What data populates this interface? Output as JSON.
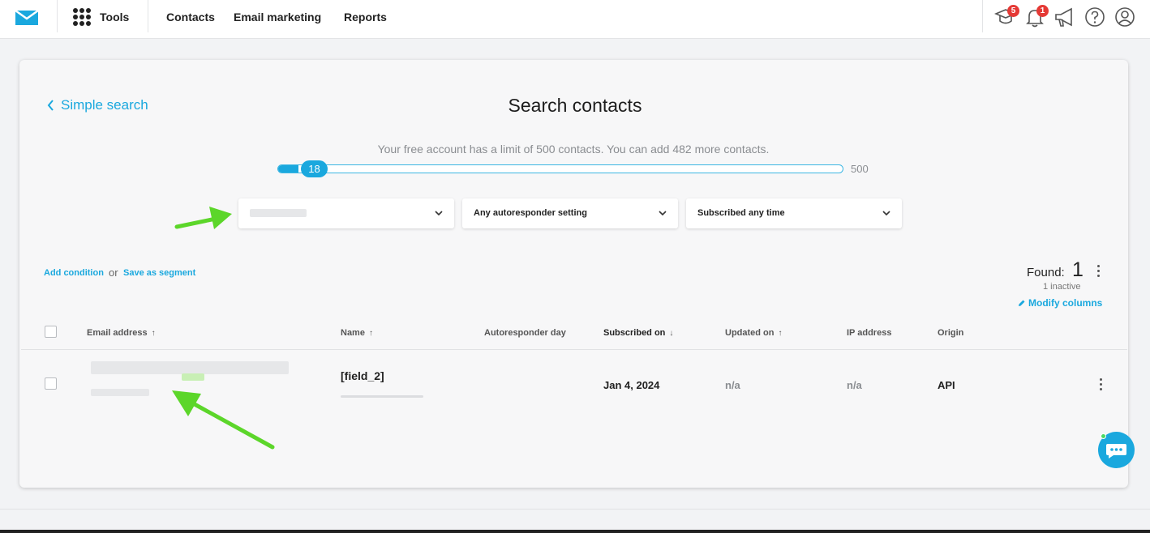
{
  "nav": {
    "tools_label": "Tools",
    "links": [
      "Contacts",
      "Email marketing",
      "Reports"
    ],
    "icons": {
      "logo": "envelope-logo-icon",
      "apps": "apps-grid-icon",
      "learning": "graduation-cap-icon",
      "notifications": "bell-icon",
      "announcements": "megaphone-icon",
      "help": "help-icon",
      "account": "user-icon"
    },
    "learning_badge": "5",
    "notifications_badge": "1"
  },
  "page": {
    "back_label": "Simple search",
    "title": "Search contacts",
    "limit_text": "Your free account has a limit of 500 contacts. You can add 482 more contacts.",
    "slider": {
      "value": 18,
      "value_label": "18",
      "max": 500,
      "max_label": "500"
    }
  },
  "filters": {
    "list_value": "",
    "autoresponder_value": "Any autoresponder setting",
    "subscribed_value": "Subscribed any time"
  },
  "conditions": {
    "add_label": "Add condition",
    "or_label": "or",
    "save_label": "Save as segment"
  },
  "results": {
    "found_label": "Found:",
    "found_value": "1",
    "inactive_label": "1 inactive",
    "modify_label": "Modify columns"
  },
  "table": {
    "columns": [
      {
        "label": "Email address",
        "sort": "↑"
      },
      {
        "label": "Name",
        "sort": "↑"
      },
      {
        "label": "Autoresponder day",
        "sort": ""
      },
      {
        "label": "Subscribed on",
        "sort": "↓"
      },
      {
        "label": "Updated on",
        "sort": "↑"
      },
      {
        "label": "IP address",
        "sort": ""
      },
      {
        "label": "Origin",
        "sort": ""
      }
    ],
    "rows": [
      {
        "email": "",
        "name": "[field_2]",
        "autoresponder_day": "",
        "subscribed_on": "Jan 4, 2024",
        "updated_on": "n/a",
        "ip_address": "n/a",
        "origin": "API"
      }
    ]
  },
  "colors": {
    "accent": "#1aa8de",
    "badge": "#e53935",
    "annotation_arrow": "#5cd62a"
  }
}
